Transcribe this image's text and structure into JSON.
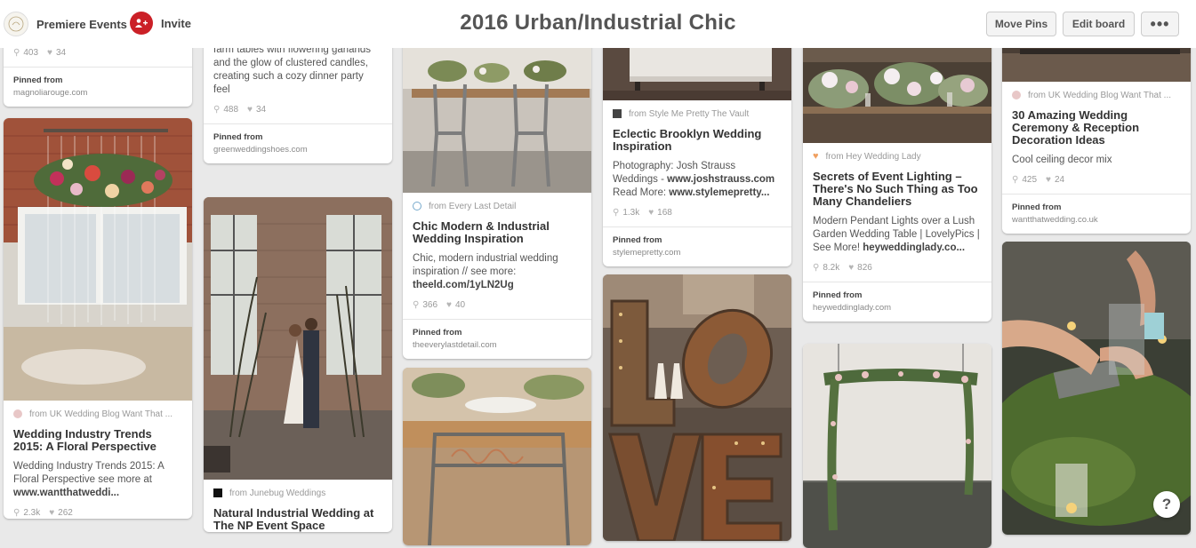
{
  "header": {
    "owner_name": "Premiere Events",
    "invite_label": "Invite",
    "board_title": "2016 Urban/Industrial Chic",
    "move_pins_label": "Move Pins",
    "edit_board_label": "Edit board",
    "more_label": "•••"
  },
  "pins": [
    {
      "stats": {
        "repins": "403",
        "likes": "34"
      },
      "pinned_from_label": "Pinned from",
      "pinned_from_domain": "magnoliarouge.com"
    },
    {
      "source": "from UK Wedding Blog Want That ...",
      "title": "Wedding Industry Trends 2015: A Floral Perspective",
      "description": "Wedding Industry Trends 2015: A Floral Perspective see more at ",
      "link": "www.wantthatweddi...",
      "stats": {
        "repins": "2.3k",
        "likes": "262"
      }
    },
    {
      "description": "Industrial wedding reception - long farm tables with flowering garlands and the glow of clustered candles, creating such a cozy dinner party feel",
      "stats": {
        "repins": "488",
        "likes": "34"
      },
      "pinned_from_label": "Pinned from",
      "pinned_from_domain": "greenweddingshoes.com"
    },
    {
      "source": "from Junebug Weddings",
      "title": "Natural Industrial Wedding at The NP Event Space"
    },
    {
      "source": "from Every Last Detail",
      "title": "Chic Modern & Industrial Wedding Inspiration",
      "description": "Chic, modern industrial wedding inspiration // see more: ",
      "link": "theeld.com/1yLN2Ug",
      "stats": {
        "repins": "366",
        "likes": "40"
      },
      "pinned_from_label": "Pinned from",
      "pinned_from_domain": "theeverylastdetail.com"
    },
    {},
    {
      "source": "from Style Me Pretty The Vault",
      "title": "Eclectic Brooklyn Wedding Inspiration",
      "description": "Photography: Josh Strauss Weddings - ",
      "link": "www.joshstrauss.com",
      "description2": " Read More: ",
      "link2": "www.stylemepretty...",
      "stats": {
        "repins": "1.3k",
        "likes": "168"
      },
      "pinned_from_label": "Pinned from",
      "pinned_from_domain": "stylemepretty.com"
    },
    {},
    {
      "source": "from Hey Wedding Lady",
      "title": "Secrets of Event Lighting – There's No Such Thing as Too Many Chandeliers",
      "description": "Modern Pendant Lights over a Lush Garden Wedding Table | LovelyPics | See More! ",
      "link": "heyweddinglady.co...",
      "stats": {
        "repins": "8.2k",
        "likes": "826"
      },
      "pinned_from_label": "Pinned from",
      "pinned_from_domain": "heyweddinglady.com"
    },
    {},
    {
      "source": "from UK Wedding Blog Want That ...",
      "title": "30 Amazing Wedding Ceremony & Reception Decoration Ideas",
      "description": "Cool ceiling decor mix",
      "stats": {
        "repins": "425",
        "likes": "24"
      },
      "pinned_from_label": "Pinned from",
      "pinned_from_domain": "wantthatwedding.co.uk"
    },
    {}
  ],
  "help_label": "?",
  "colors": {
    "accent": "#cb2027",
    "background": "#e9e9e9"
  }
}
